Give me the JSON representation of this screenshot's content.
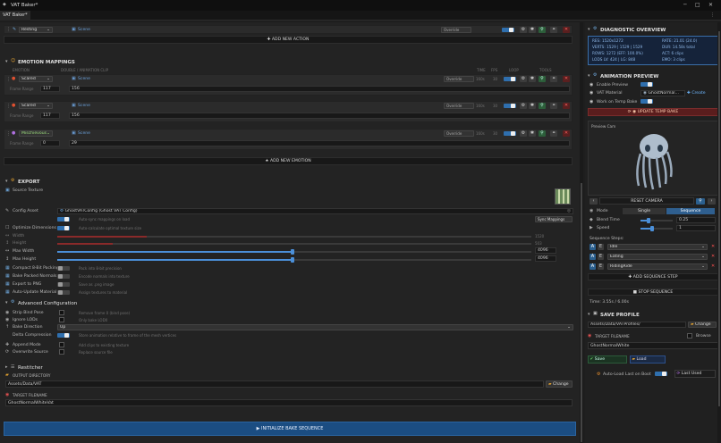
{
  "window": {
    "title": "VAT Baker*",
    "tab": "VAT Baker*"
  },
  "actions": {
    "row_state": "Resting",
    "row_action": "Scene",
    "override": "Override",
    "add_label": "ADD NEW ACTION"
  },
  "emotions": {
    "title": "EMOTION MAPPINGS",
    "col_emotion": "EMOTION",
    "col_double": "DOUBLE / ANIMATION CLIP",
    "col_time": "TIME",
    "col_fps": "FPS",
    "col_loop": "LOOP",
    "col_tools": "TOOLS",
    "rows": [
      {
        "name": "Scared",
        "clip": "Scene",
        "override": "Override",
        "time": "160s",
        "fps": "30",
        "range_label": "Frame Range",
        "start": "117",
        "end": "156"
      },
      {
        "name": "Scared",
        "clip": "Scene",
        "override": "Override",
        "time": "160s",
        "fps": "30",
        "range_label": "Frame Range",
        "start": "117",
        "end": "156"
      },
      {
        "name": "Mischievous",
        "clip": "Scene",
        "override": "Override",
        "time": "160s",
        "fps": "30",
        "range_label": "Frame Range",
        "start": "0",
        "end": "29"
      }
    ],
    "add_label": "ADD NEW EMOTION"
  },
  "export": {
    "title": "EXPORT",
    "source_texture": "Source Texture",
    "config_label": "Config Asset",
    "config_value": "GhostVATConfig (Ghost VAT Config)",
    "opt_dims": "Optimize Dimensions",
    "opt_hint": "Auto-calculate optimal texture size",
    "width_label": "Width",
    "width_val": "1520",
    "height_label": "Height",
    "height_val": "503",
    "maxw_label": "Max Width",
    "maxw_val": "4096",
    "maxh_label": "Max Height",
    "maxh_val": "4096",
    "compact": "Compact 8-Bit Packing",
    "compact_hint": "Pack into 8-bit precision",
    "bake_normals": "Bake Packed Normals",
    "bake_hint": "Encode normals into texture",
    "export_png": "Export to PNG",
    "export_hint": "Save as .png image",
    "auto_update": "Auto-Update Material",
    "auto_hint": "Assign textures to material",
    "sync_btn": "Sync Mappings",
    "top_hint": "Auto-sync mappings on load"
  },
  "advanced": {
    "title": "Advanced Configuration",
    "strip": "Strip Bind Pose",
    "strip_hint": "Remove frame 0 (bind pose)",
    "ignore": "Ignore LODs",
    "ignore_hint": "Only bake LOD0",
    "dir_label": "Bake Direction",
    "dir_val": "Up",
    "delta": "Delta Compression",
    "delta_hint": "Store animation relative to frame of the mesh vertices",
    "append": "Append Mode",
    "append_hint": "Add clips to existing texture",
    "overwrite": "Overwrite Source",
    "overwrite_hint": "Replace source file"
  },
  "restitcher": {
    "title": "Restitcher",
    "out_dir_label": "OUTPUT DIRECTORY",
    "out_dir_val": "Assets/Data/VAT",
    "change": "Change",
    "target_label": "TARGET FILENAME",
    "target_val": "GhostNormalWhiteVat"
  },
  "init_btn": "INITIALIZE BAKE SEQUENCE",
  "diag": {
    "title": "DIAGNOSTIC OVERVIEW",
    "l1": "RES: 1520x1272",
    "l2": "VERTS: 1529 | 1529 | 1529",
    "l3": "ROWS: 1272 (EFF: 100.0%)",
    "l4": "LODS LV: 424 | LG: 848",
    "r1": "RATE: 21.01 (24.0)",
    "r2": "DUR: 14.58s total",
    "r3": "ACT: 6 clips",
    "r4": "EMO: 3 clips"
  },
  "anim": {
    "title": "ANIMATION PREVIEW",
    "enable": "Enable Preview",
    "material": "VAT Material",
    "material_val": "GhostNormal...",
    "create": "Create",
    "work_temp": "Work on Temp Bake",
    "update_temp": "UPDATE TEMP BAKE",
    "preview_cam": "Preview Cam",
    "reset_cam": "RESET CAMERA",
    "mode_label": "Mode",
    "mode_single": "Single",
    "mode_seq": "Sequence",
    "blend_label": "Blend Time",
    "blend_val": "0.25",
    "blend_pct": 0.25,
    "speed_label": "Speed",
    "speed_val": "1",
    "speed_pct": 0.35,
    "steps_title": "Sequence Steps:",
    "steps": [
      {
        "a": "A",
        "e": "E",
        "clip": "Idle"
      },
      {
        "a": "A",
        "e": "E",
        "clip": "Eating"
      },
      {
        "a": "A",
        "e": "E",
        "clip": "RidingRide"
      }
    ],
    "add_step": "ADD SEQUENCE STEP",
    "stop_seq": "STOP SEQUENCE",
    "time": "Time: 3.55s / 6.00s"
  },
  "save": {
    "title": "SAVE PROFILE",
    "path": "Assets/Data/VATProfiles/",
    "change": "Change",
    "target_label": "TARGET FILENAME",
    "browse": "Browse",
    "target_val": "GhostNormalWhite",
    "save_btn": "Save",
    "load_btn": "Load",
    "auto_load": "Auto-Load Last on Boot",
    "last_used": "Last Used"
  },
  "colors": {
    "accent": "#4b8fd8",
    "blue_btn": "#1f5f9e",
    "red": "#ff5050",
    "orange": "#e08a2c",
    "bar_dark": "#5a1d1d"
  }
}
